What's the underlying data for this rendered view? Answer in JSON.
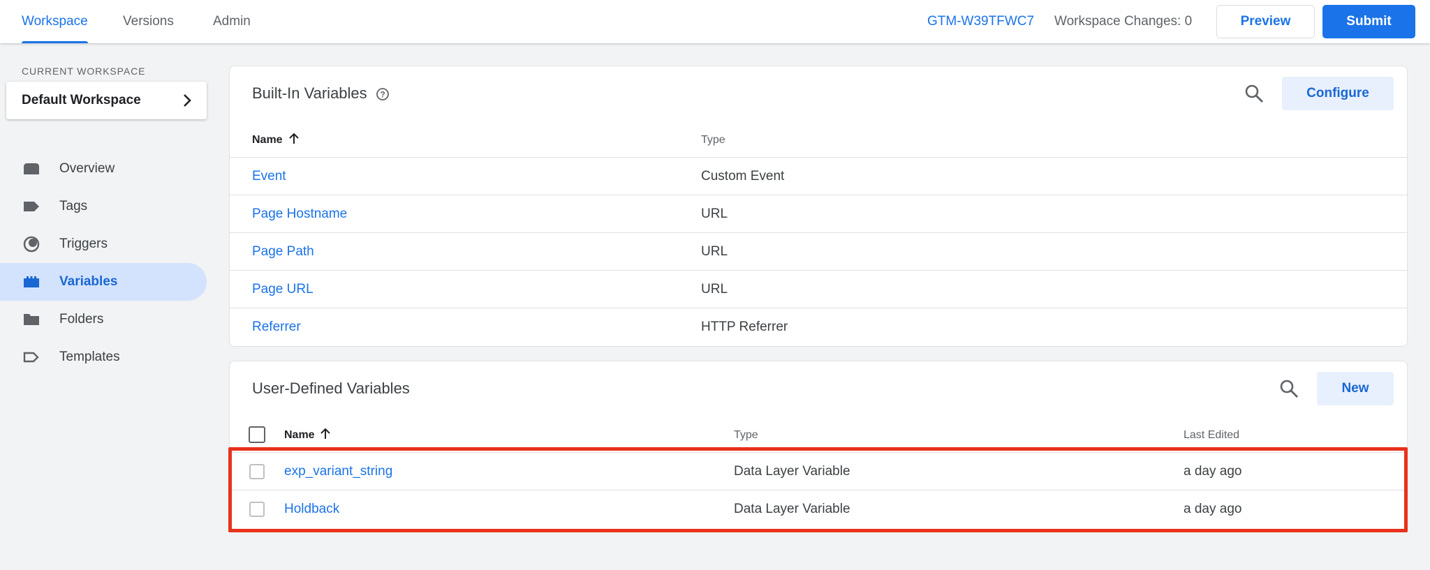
{
  "topbar": {
    "tabs": [
      {
        "label": "Workspace"
      },
      {
        "label": "Versions"
      },
      {
        "label": "Admin"
      }
    ],
    "container_id": "GTM-W39TFWC7",
    "workspace_changes": "Workspace Changes: 0",
    "preview_label": "Preview",
    "submit_label": "Submit"
  },
  "sidebar": {
    "caption": "CURRENT WORKSPACE",
    "workspace_name": "Default Workspace",
    "items": [
      {
        "label": "Overview",
        "icon": "overview-icon"
      },
      {
        "label": "Tags",
        "icon": "tag-icon"
      },
      {
        "label": "Triggers",
        "icon": "trigger-icon"
      },
      {
        "label": "Variables",
        "icon": "variables-icon",
        "active": true
      },
      {
        "label": "Folders",
        "icon": "folder-icon"
      },
      {
        "label": "Templates",
        "icon": "template-icon"
      }
    ]
  },
  "builtin": {
    "title": "Built-In Variables",
    "configure_label": "Configure",
    "col_name": "Name",
    "col_type": "Type",
    "rows": [
      {
        "name": "Event",
        "type": "Custom Event"
      },
      {
        "name": "Page Hostname",
        "type": "URL"
      },
      {
        "name": "Page Path",
        "type": "URL"
      },
      {
        "name": "Page URL",
        "type": "URL"
      },
      {
        "name": "Referrer",
        "type": "HTTP Referrer"
      }
    ]
  },
  "userdefined": {
    "title": "User-Defined Variables",
    "new_label": "New",
    "col_name": "Name",
    "col_type": "Type",
    "col_edited": "Last Edited",
    "rows": [
      {
        "name": "exp_variant_string",
        "type": "Data Layer Variable",
        "edited": "a day ago"
      },
      {
        "name": "Holdback",
        "type": "Data Layer Variable",
        "edited": "a day ago"
      }
    ]
  },
  "colors": {
    "accent": "#1a73e8",
    "highlight": "#e8321c",
    "active_nav_bg": "#d3e3fd"
  }
}
